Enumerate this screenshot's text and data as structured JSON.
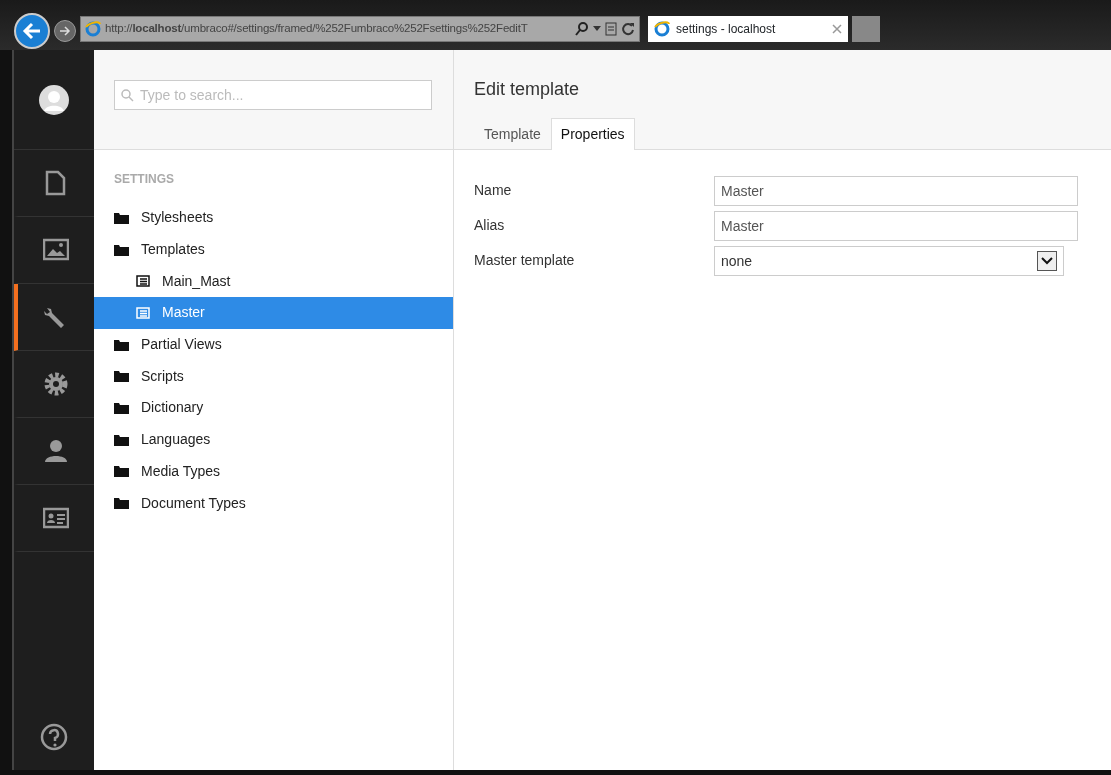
{
  "browser": {
    "url": "http://**localhost**/umbraco#/settings/framed/%252Fumbraco%252Fsettings%252FeditT",
    "tab_title": "settings - localhost"
  },
  "sections": [
    {
      "kind": "document",
      "selected": false
    },
    {
      "kind": "media",
      "selected": false
    },
    {
      "kind": "settings",
      "selected": true
    },
    {
      "kind": "developer",
      "selected": false
    },
    {
      "kind": "users",
      "selected": false
    },
    {
      "kind": "members",
      "selected": false
    }
  ],
  "search": {
    "placeholder": "Type to search..."
  },
  "tree": {
    "heading": "SETTINGS",
    "items": [
      {
        "label": "Stylesheets",
        "kind": "folder",
        "selected": false
      },
      {
        "label": "Templates",
        "kind": "folder",
        "selected": false,
        "children": [
          {
            "label": "Main_Mast",
            "kind": "template",
            "selected": false
          },
          {
            "label": "Master",
            "kind": "template",
            "selected": true
          }
        ]
      },
      {
        "label": "Partial Views",
        "kind": "folder",
        "selected": false
      },
      {
        "label": "Scripts",
        "kind": "folder",
        "selected": false
      },
      {
        "label": "Dictionary",
        "kind": "folder",
        "selected": false
      },
      {
        "label": "Languages",
        "kind": "folder",
        "selected": false
      },
      {
        "label": "Media Types",
        "kind": "folder",
        "selected": false
      },
      {
        "label": "Document Types",
        "kind": "folder",
        "selected": false
      }
    ]
  },
  "editor": {
    "title": "Edit template",
    "tabs": [
      {
        "label": "Template",
        "selected": false
      },
      {
        "label": "Properties",
        "selected": true
      }
    ],
    "fields": [
      {
        "label": "Name",
        "kind": "text",
        "value": "Master"
      },
      {
        "label": "Alias",
        "kind": "text",
        "value": "Master"
      },
      {
        "label": "Master template",
        "kind": "select",
        "value": "none"
      }
    ]
  }
}
